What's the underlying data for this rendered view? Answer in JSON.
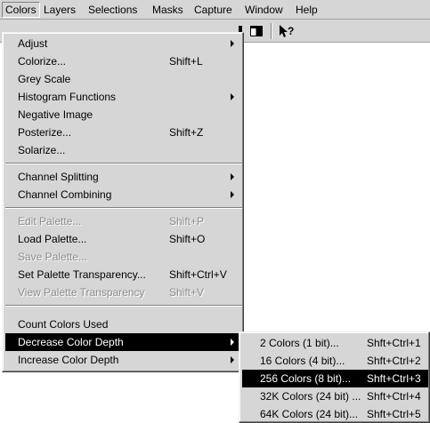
{
  "menubar": {
    "items": [
      "Colors",
      "Layers",
      "Selections",
      "Masks",
      "Capture",
      "Window",
      "Help"
    ]
  },
  "toolbar": {
    "icons": [
      "window-tile-icon",
      "context-help-icon"
    ],
    "help_glyph": "?"
  },
  "colors_menu": {
    "items": [
      {
        "label": "Adjust",
        "shortcut": "",
        "submenu": true,
        "enabled": true
      },
      {
        "label": "Colorize...",
        "shortcut": "Shift+L",
        "submenu": false,
        "enabled": true
      },
      {
        "label": "Grey Scale",
        "shortcut": "",
        "submenu": false,
        "enabled": true
      },
      {
        "label": "Histogram Functions",
        "shortcut": "",
        "submenu": true,
        "enabled": true
      },
      {
        "label": "Negative Image",
        "shortcut": "",
        "submenu": false,
        "enabled": true
      },
      {
        "label": "Posterize...",
        "shortcut": "Shift+Z",
        "submenu": false,
        "enabled": true
      },
      {
        "label": "Solarize...",
        "shortcut": "",
        "submenu": false,
        "enabled": true
      },
      {
        "label": "Channel Splitting",
        "shortcut": "",
        "submenu": true,
        "enabled": true
      },
      {
        "label": "Channel Combining",
        "shortcut": "",
        "submenu": true,
        "enabled": true
      },
      {
        "label": "Edit Palette...",
        "shortcut": "Shift+P",
        "submenu": false,
        "enabled": false
      },
      {
        "label": "Load Palette...",
        "shortcut": "Shift+O",
        "submenu": false,
        "enabled": true
      },
      {
        "label": "Save Palette...",
        "shortcut": "",
        "submenu": false,
        "enabled": false
      },
      {
        "label": "Set Palette Transparency...",
        "shortcut": "Shift+Ctrl+V",
        "submenu": false,
        "enabled": true
      },
      {
        "label": "View Palette Transparency",
        "shortcut": "Shift+V",
        "submenu": false,
        "enabled": false
      },
      {
        "label": "Count Colors Used",
        "shortcut": "",
        "submenu": false,
        "enabled": true
      },
      {
        "label": "Decrease Color Depth",
        "shortcut": "",
        "submenu": true,
        "enabled": true,
        "selected": true
      },
      {
        "label": "Increase Color Depth",
        "shortcut": "",
        "submenu": true,
        "enabled": true
      }
    ]
  },
  "depth_submenu": {
    "items": [
      {
        "label": "2 Colors (1 bit)...",
        "shortcut": "Shft+Ctrl+1"
      },
      {
        "label": "16 Colors (4 bit)...",
        "shortcut": "Shft+Ctrl+2"
      },
      {
        "label": "256 Colors (8 bit)...",
        "shortcut": "Shft+Ctrl+3",
        "selected": true
      },
      {
        "label": "32K Colors (24 bit) ...",
        "shortcut": "Shft+Ctrl+4"
      },
      {
        "label": "64K Colors (24 bit)...",
        "shortcut": "Shft+Ctrl+5"
      }
    ]
  },
  "colors": {
    "menu_bg": "#d6d6d6",
    "highlight": "#000000",
    "disabled_text": "#8c8c8c"
  }
}
